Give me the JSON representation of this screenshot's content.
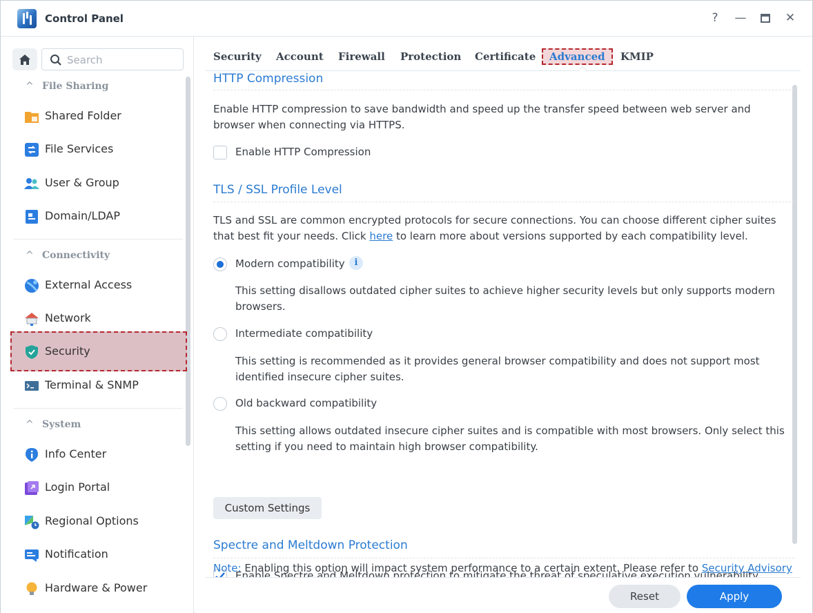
{
  "window": {
    "title": "Control Panel",
    "help": "?",
    "minimize": "—",
    "maximize": "□",
    "close": "✕"
  },
  "sidebar": {
    "search_placeholder": "Search",
    "sections": [
      {
        "label": "File Sharing",
        "items": [
          {
            "label": "Shared Folder",
            "icon": "shared-folder-icon"
          },
          {
            "label": "File Services",
            "icon": "file-services-icon"
          },
          {
            "label": "User & Group",
            "icon": "user-group-icon"
          },
          {
            "label": "Domain/LDAP",
            "icon": "domain-ldap-icon"
          }
        ]
      },
      {
        "label": "Connectivity",
        "items": [
          {
            "label": "External Access",
            "icon": "external-access-icon"
          },
          {
            "label": "Network",
            "icon": "network-icon"
          },
          {
            "label": "Security",
            "icon": "security-shield-icon",
            "active": true
          },
          {
            "label": "Terminal & SNMP",
            "icon": "terminal-icon"
          }
        ]
      },
      {
        "label": "System",
        "items": [
          {
            "label": "Info Center",
            "icon": "info-center-icon"
          },
          {
            "label": "Login Portal",
            "icon": "login-portal-icon"
          },
          {
            "label": "Regional Options",
            "icon": "regional-options-icon"
          },
          {
            "label": "Notification",
            "icon": "notification-icon"
          },
          {
            "label": "Hardware & Power",
            "icon": "hardware-power-icon"
          }
        ]
      }
    ]
  },
  "tabs": [
    "Security",
    "Account",
    "Firewall",
    "Protection",
    "Certificate",
    "Advanced",
    "KMIP"
  ],
  "active_tab": "Advanced",
  "http_compression": {
    "heading": "HTTP Compression",
    "description": "Enable HTTP compression to save bandwidth and speed up the transfer speed between web server and browser when connecting via HTTPS.",
    "checkbox_label": "Enable HTTP Compression",
    "checked": false
  },
  "tls": {
    "heading": "TLS / SSL Profile Level",
    "description_before": "TLS and SSL are common encrypted protocols for secure connections. You can choose different cipher suites that best fit your needs. Click ",
    "link": "here",
    "description_after": " to learn more about versions supported by each compatibility level.",
    "options": [
      {
        "label": "Modern compatibility",
        "selected": true,
        "description": "This setting disallows outdated cipher suites to achieve higher security levels but only supports modern browsers."
      },
      {
        "label": "Intermediate compatibility",
        "selected": false,
        "description": "This setting is recommended as it provides general browser compatibility and does not support most identified insecure cipher suites."
      },
      {
        "label": "Old backward compatibility",
        "selected": false,
        "description": "This setting allows outdated insecure cipher suites and is compatible with most browsers. Only select this setting if you need to maintain high browser compatibility."
      }
    ],
    "info_glyph": "i",
    "custom_button": "Custom Settings"
  },
  "spectre": {
    "heading": "Spectre and Meltdown Protection",
    "checkbox_label": "Enable Spectre and Meltdown protection to mitigate the threat of speculative execution vulnerability",
    "checked": true,
    "note_label": "Note:",
    "note_text": " Enabling this option will impact system performance to a certain extent. Please refer to ",
    "note_link": "Security Advisory"
  },
  "footer": {
    "reset": "Reset",
    "apply": "Apply"
  },
  "colors": {
    "accent": "#2a7bd1",
    "apply_button": "#1e7be8",
    "highlight_border": "#b3272d",
    "active_item_bg": "#dcbfc5"
  }
}
